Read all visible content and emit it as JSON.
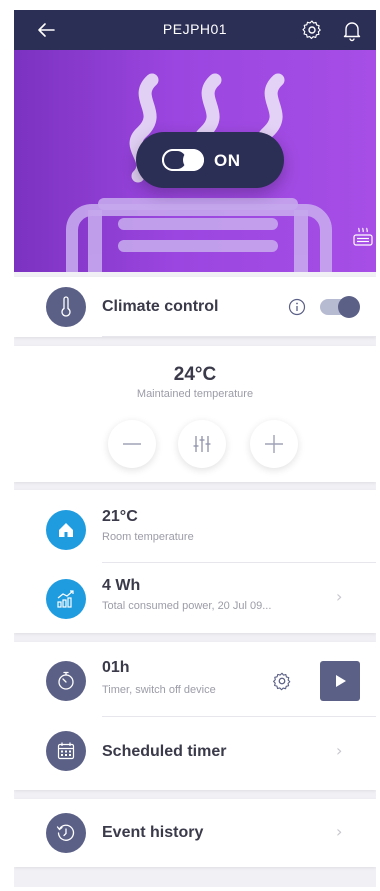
{
  "header": {
    "title": "PEJPH01",
    "back_icon": "arrow-left-icon",
    "settings_icon": "gear-icon",
    "notifications_icon": "bell-icon",
    "background": "#2b2e55"
  },
  "hero": {
    "power_label": "ON",
    "power_on": true,
    "gradient_start": "#7c32c0",
    "gradient_end": "#a64ee6",
    "device_icon": "heater-icon"
  },
  "climate_control": {
    "label": "Climate control",
    "enabled": true,
    "info_icon": "info-icon",
    "icon": "thermometer-icon"
  },
  "temperature_panel": {
    "value": "24°C",
    "subtitle": "Maintained temperature",
    "decrease_icon": "minus-icon",
    "settings_icon": "sliders-icon",
    "increase_icon": "plus-icon"
  },
  "room_temperature": {
    "value": "21°C",
    "subtitle": "Room temperature",
    "icon": "home-icon",
    "icon_color": "#1f9be0"
  },
  "power_consumption": {
    "value": "4 Wh",
    "subtitle": "Total consumed power, 20 Jul 09...",
    "icon": "chart-icon",
    "icon_color": "#1f9be0"
  },
  "timer": {
    "value": "01h",
    "subtitle": "Timer, switch off device",
    "icon": "stopwatch-icon",
    "settings_icon": "gear-icon",
    "play_icon": "play-icon"
  },
  "scheduled_timer": {
    "label": "Scheduled timer",
    "icon": "calendar-icon"
  },
  "event_history": {
    "label": "Event history",
    "icon": "history-icon"
  },
  "colors": {
    "accent": "#5b6086",
    "blue": "#1f9be0",
    "text": "#3a3a4a",
    "muted": "#9c9ca8"
  }
}
